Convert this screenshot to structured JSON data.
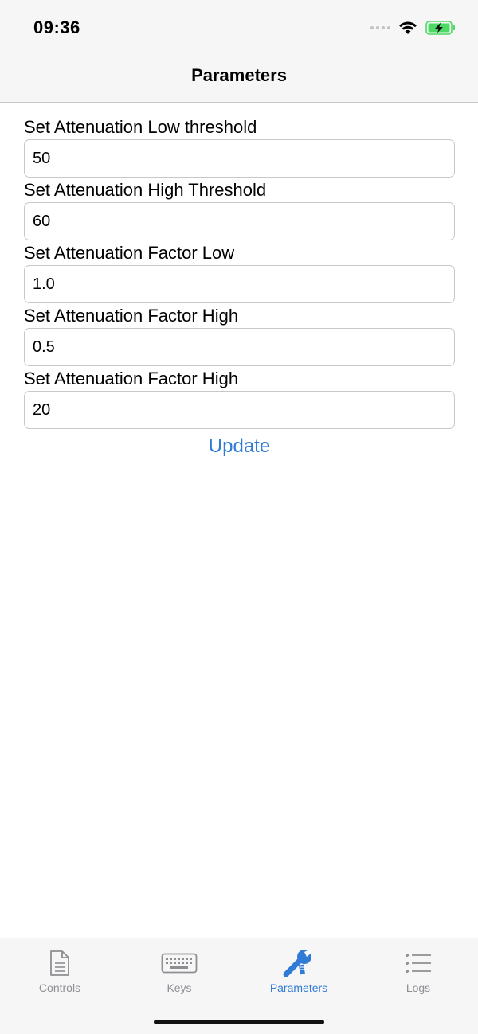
{
  "status_bar": {
    "time": "09:36"
  },
  "nav": {
    "title": "Parameters"
  },
  "form": {
    "fields": [
      {
        "label": "Set Attenuation Low threshold",
        "value": "50"
      },
      {
        "label": "Set Attenuation High Threshold",
        "value": "60"
      },
      {
        "label": "Set Attenuation Factor Low",
        "value": "1.0"
      },
      {
        "label": "Set Attenuation Factor High",
        "value": "0.5"
      },
      {
        "label": "Set Attenuation Factor High",
        "value": "20"
      }
    ],
    "update_label": "Update"
  },
  "tabbar": {
    "tabs": [
      {
        "label": "Controls",
        "icon": "document-icon",
        "active": false
      },
      {
        "label": "Keys",
        "icon": "keyboard-icon",
        "active": false
      },
      {
        "label": "Parameters",
        "icon": "wrench-icon",
        "active": true
      },
      {
        "label": "Logs",
        "icon": "list-icon",
        "active": false
      }
    ]
  },
  "colors": {
    "accent": "#2f7bd6",
    "inactive_tab": "#8e8e93",
    "battery_fill": "#4cd964"
  }
}
